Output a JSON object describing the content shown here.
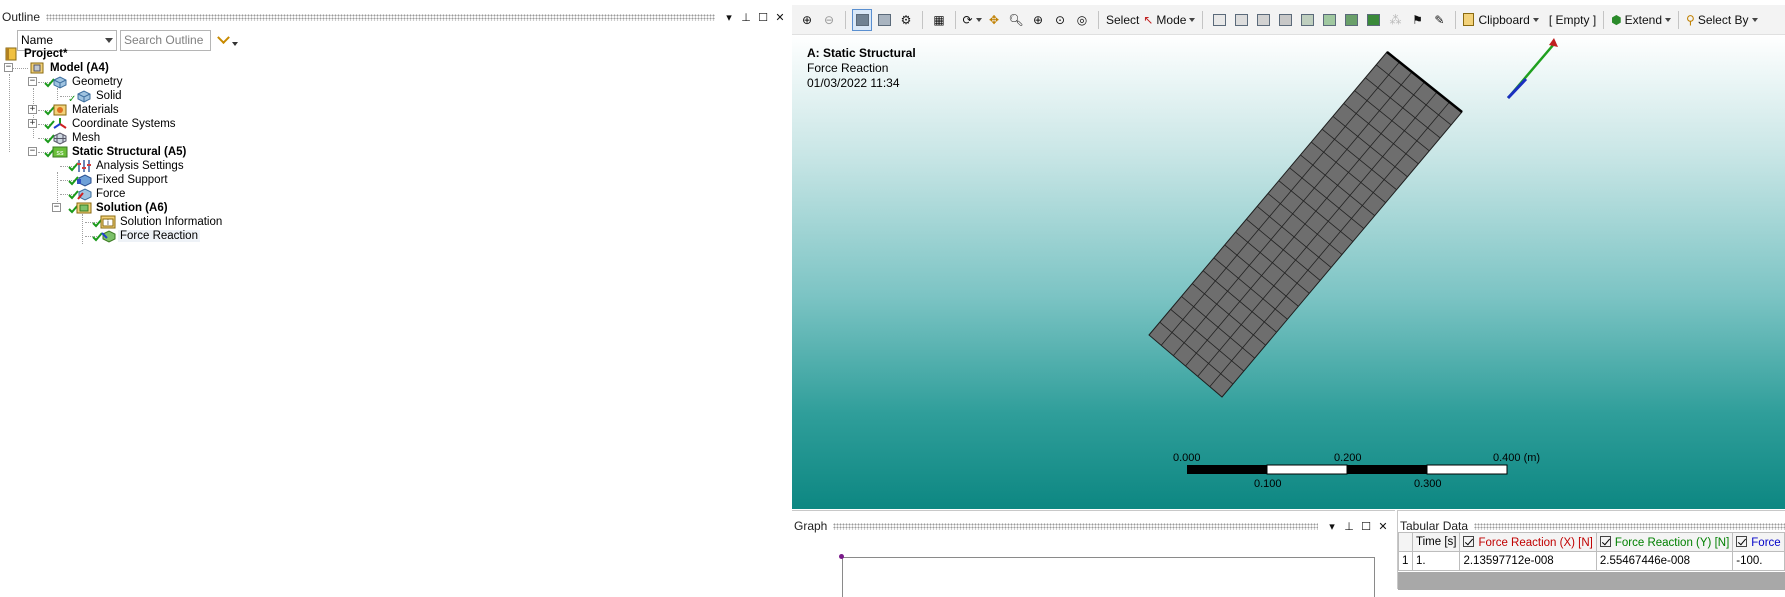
{
  "outline": {
    "title": "Outline",
    "filter_select": "Name",
    "search_placeholder": "Search Outline",
    "tree": [
      {
        "label": "Project*",
        "bold": true
      },
      {
        "label": "Model (A4)",
        "bold": true
      },
      {
        "label": "Geometry"
      },
      {
        "label": "Solid"
      },
      {
        "label": "Materials"
      },
      {
        "label": "Coordinate Systems"
      },
      {
        "label": "Mesh"
      },
      {
        "label": "Static Structural (A5)",
        "bold": true
      },
      {
        "label": "Analysis Settings"
      },
      {
        "label": "Fixed Support"
      },
      {
        "label": "Force"
      },
      {
        "label": "Solution (A6)",
        "bold": true
      },
      {
        "label": "Solution Information"
      },
      {
        "label": "Force Reaction",
        "selected": true
      }
    ]
  },
  "graphics_toolbar": {
    "select_label": "Select",
    "mode_label": "Mode",
    "clipboard_label": "Clipboard",
    "empty_label": "[ Empty ]",
    "extend_label": "Extend",
    "select_by_label": "Select By"
  },
  "viewport": {
    "analysis_title": "A: Static Structural",
    "result_name": "Force Reaction",
    "timestamp": "01/03/2022 11:34",
    "scale_top": [
      "0.000",
      "0.200",
      "0.400 (m)"
    ],
    "scale_bottom": [
      "0.100",
      "0.300"
    ],
    "colors": {
      "mesh_fill": "#6e6e6e",
      "bg_top": "#ffffff",
      "bg_bottom": "#0d8782"
    }
  },
  "graph": {
    "title": "Graph"
  },
  "tabular": {
    "title": "Tabular Data",
    "headers": [
      "Time [s]",
      "Force Reaction (X) [N]",
      "Force Reaction (Y) [N]",
      "Force"
    ],
    "header_colors": [
      "#000000",
      "#c00000",
      "#008000",
      "#0000c8"
    ],
    "rows": [
      [
        "1",
        "1.",
        "2.13597712e-008",
        "2.55467446e-008",
        "-100."
      ]
    ]
  }
}
